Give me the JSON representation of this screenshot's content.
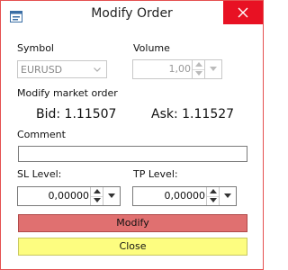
{
  "window": {
    "title": "Modify Order"
  },
  "icons": {
    "app": "app-icon",
    "close": "close-icon",
    "combo_arrow": "chevron-down-icon",
    "spin_up": "spin-up-icon",
    "spin_down": "spin-down-icon"
  },
  "colors": {
    "close_button": "#e81123",
    "modify_button": "#e07070",
    "close_order_button": "#fdfd80",
    "window_border": "#e55050"
  },
  "form": {
    "symbol_label": "Symbol",
    "symbol_value": "EURUSD",
    "volume_label": "Volume",
    "volume_value": "1,00",
    "section_label": "Modify market order",
    "bid": "Bid: 1.11507",
    "ask": "Ask: 1.11527",
    "comment_label": "Comment",
    "comment_value": "",
    "sl_label": "SL Level:",
    "sl_value": "0,00000",
    "tp_label": "TP Level:",
    "tp_value": "0,00000"
  },
  "buttons": {
    "modify": "Modify",
    "close": "Close"
  }
}
